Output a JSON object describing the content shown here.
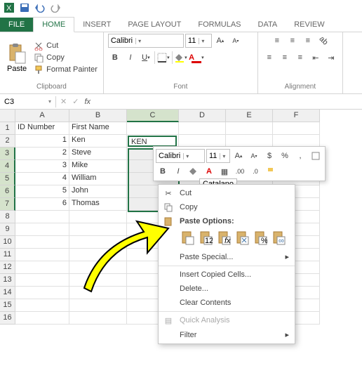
{
  "qat": {
    "icons": [
      "excel",
      "save",
      "undo",
      "redo"
    ]
  },
  "tabs": [
    "FILE",
    "HOME",
    "INSERT",
    "PAGE LAYOUT",
    "FORMULAS",
    "DATA",
    "REVIEW"
  ],
  "activeTab": 1,
  "ribbon": {
    "clipboard": {
      "label": "Clipboard",
      "paste": "Paste",
      "cut": "Cut",
      "copy": "Copy",
      "painter": "Format Painter"
    },
    "font": {
      "label": "Font",
      "name": "Calibri",
      "size": "11"
    },
    "alignment": {
      "label": "Alignment"
    }
  },
  "namebox": "C3",
  "columns": [
    "A",
    "B",
    "C",
    "D",
    "E",
    "F"
  ],
  "selCol": "C",
  "selRows": [
    3,
    4,
    5,
    6,
    7
  ],
  "data": {
    "headers": [
      "ID Number",
      "First Name"
    ],
    "rows": [
      {
        "id": "1",
        "first": "Ken",
        "last": "KEN"
      },
      {
        "id": "2",
        "first": "Steve",
        "last": ""
      },
      {
        "id": "3",
        "first": "Mike",
        "last": ""
      },
      {
        "id": "4",
        "first": "William",
        "last": ""
      },
      {
        "id": "5",
        "first": "John",
        "last": ""
      },
      {
        "id": "6",
        "first": "Thomas",
        "last": ""
      }
    ],
    "dcell": "Catalano"
  },
  "minitool": {
    "font": "Calibri",
    "size": "11"
  },
  "context": {
    "cut": "Cut",
    "copy": "Copy",
    "pasteOptions": "Paste Options:",
    "pasteSpecial": "Paste Special...",
    "insert": "Insert Copied Cells...",
    "delete": "Delete...",
    "clear": "Clear Contents",
    "quick": "Quick Analysis",
    "filter": "Filter"
  }
}
